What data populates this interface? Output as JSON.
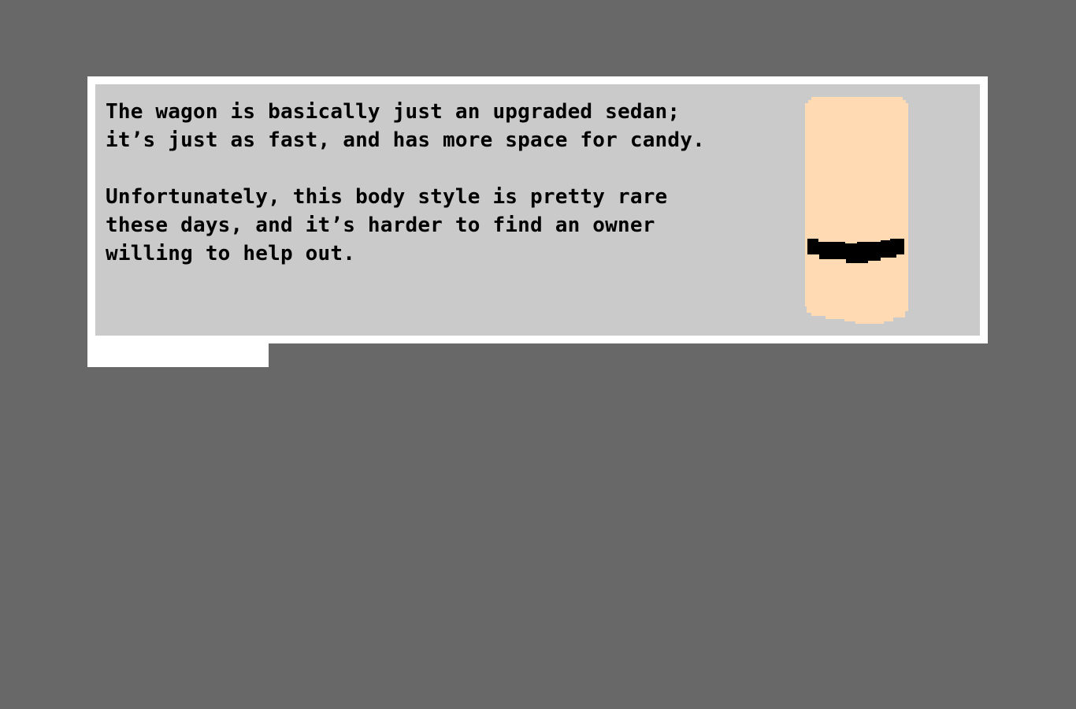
{
  "dialog": {
    "lines": [
      "The wagon is basically just an upgraded sedan;",
      "it’s just as fast, and has more space for candy.",
      "",
      "Unfortunately, this body style is pretty rare",
      "these days, and it’s harder to find an owner",
      "willing to help out."
    ]
  },
  "portrait": {
    "icon": "candy-bar-car-icon",
    "body_color": "#ffdab3",
    "band_color": "#000000"
  },
  "colors": {
    "background": "#686868",
    "frame": "#ffffff",
    "panel": "#cacaca",
    "text": "#000000"
  }
}
